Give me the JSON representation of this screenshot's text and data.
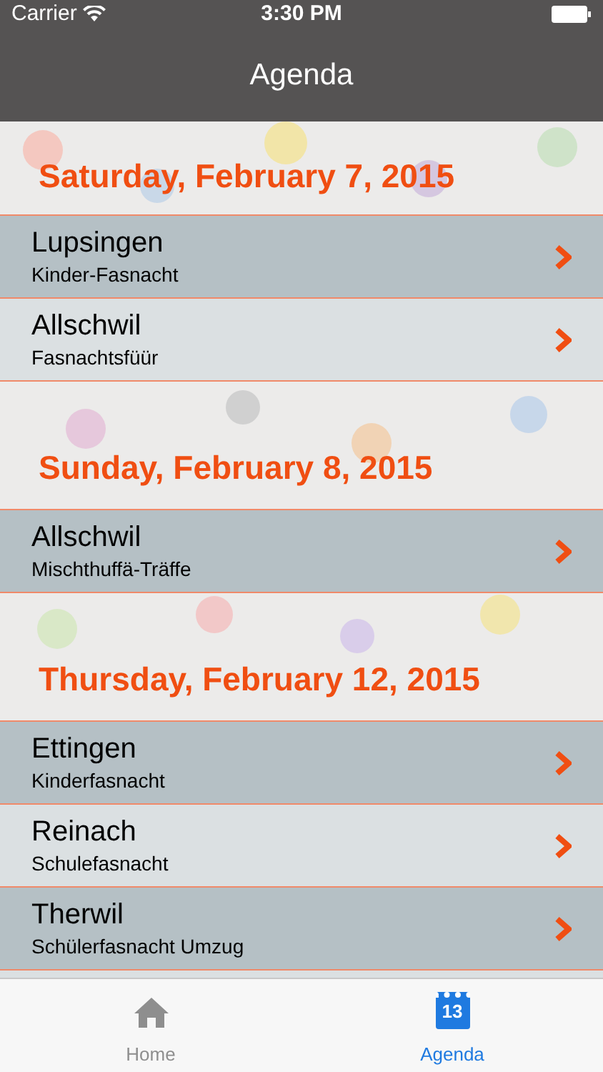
{
  "status_bar": {
    "carrier": "Carrier",
    "time": "3:30 PM"
  },
  "nav_bar": {
    "title": "Agenda"
  },
  "sections": [
    {
      "date": "Saturday, February 7, 2015",
      "events": [
        {
          "place": "Lupsingen",
          "event": "Kinder-Fasnacht"
        },
        {
          "place": "Allschwil",
          "event": "Fasnachtsfüür"
        }
      ]
    },
    {
      "date": "Sunday, February 8, 2015",
      "events": [
        {
          "place": "Allschwil",
          "event": "Mischthuffä-Träffe"
        }
      ]
    },
    {
      "date": "Thursday, February 12, 2015",
      "events": [
        {
          "place": "Ettingen",
          "event": "Kinderfasnacht"
        },
        {
          "place": "Reinach",
          "event": "Schulefasnacht"
        },
        {
          "place": "Therwil",
          "event": "Schülerfasnacht Umzug"
        }
      ]
    }
  ],
  "tab_bar": [
    {
      "label": "Home",
      "kind": "home",
      "selected": false
    },
    {
      "label": "Agenda",
      "kind": "calendar",
      "icon_text": "13",
      "selected": true
    }
  ]
}
